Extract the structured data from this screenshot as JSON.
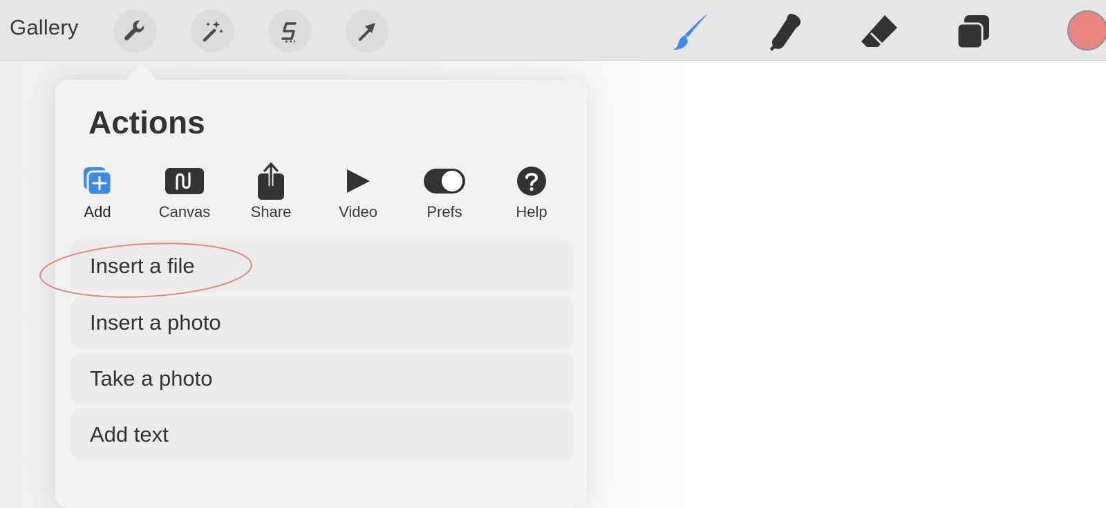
{
  "toolbar": {
    "gallery_label": "Gallery",
    "left_tools": [
      "wrench-icon",
      "magic-wand-icon",
      "selection-s-icon",
      "move-arrow-icon"
    ],
    "right_tools": [
      "brush-icon",
      "smudge-icon",
      "eraser-icon",
      "layers-icon"
    ],
    "current_color": "#E8867F"
  },
  "actions": {
    "title": "Actions",
    "tabs": [
      {
        "label": "Add",
        "icon": "add-image-icon",
        "active": true
      },
      {
        "label": "Canvas",
        "icon": "canvas-icon",
        "active": false
      },
      {
        "label": "Share",
        "icon": "share-icon",
        "active": false
      },
      {
        "label": "Video",
        "icon": "play-icon",
        "active": false
      },
      {
        "label": "Prefs",
        "icon": "toggle-icon",
        "active": false
      },
      {
        "label": "Help",
        "icon": "help-icon",
        "active": false
      }
    ],
    "items": [
      {
        "label": "Insert a file"
      },
      {
        "label": "Insert a photo"
      },
      {
        "label": "Take a photo"
      },
      {
        "label": "Add text"
      }
    ]
  },
  "colors": {
    "accent": "#3B8AF0",
    "icon_dark": "#333333",
    "annotation": "#E08A7A"
  }
}
